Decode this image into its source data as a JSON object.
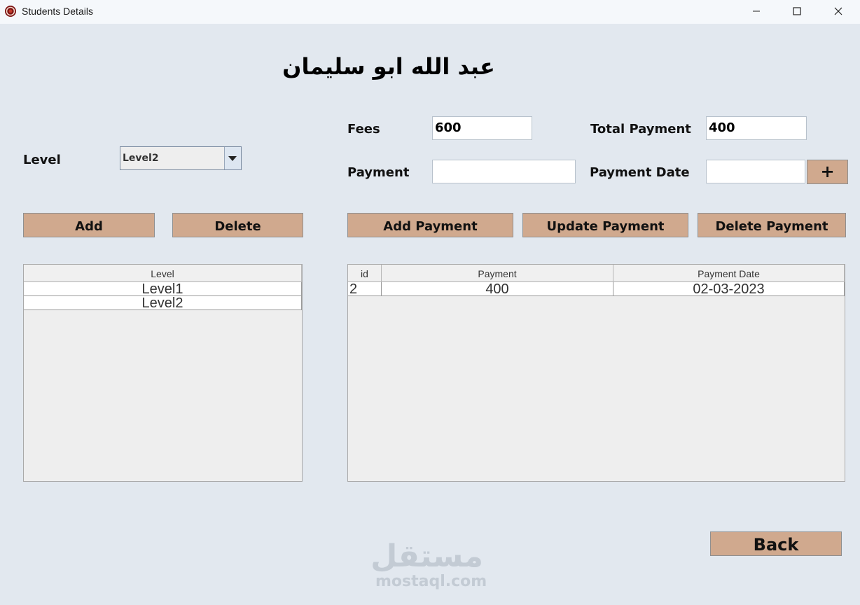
{
  "window": {
    "title": "Students Details"
  },
  "student": {
    "name": "عبد الله ابو سليمان"
  },
  "form": {
    "level_label": "Level",
    "level_selected": "Level2",
    "fees_label": "Fees",
    "fees_value": "600",
    "total_payment_label": "Total Payment",
    "total_payment_value": "400",
    "payment_label": "Payment",
    "payment_value": "",
    "payment_date_label": "Payment Date",
    "payment_date_value": "",
    "date_add_label": "+"
  },
  "buttons": {
    "add": "Add",
    "delete": "Delete",
    "add_payment": "Add Payment",
    "update_payment": "Update Payment",
    "delete_payment": "Delete Payment",
    "back": "Back"
  },
  "levels_table": {
    "columns": [
      "Level"
    ],
    "rows": [
      [
        "Level1"
      ],
      [
        "Level2"
      ]
    ]
  },
  "payments_table": {
    "columns": [
      "id",
      "Payment",
      "Payment Date"
    ],
    "rows": [
      [
        "2",
        "400",
        "02-03-2023"
      ]
    ]
  },
  "watermark": {
    "arabic": "مستقل",
    "latin": "mostaql.com"
  },
  "colors": {
    "window_bg": "#e2e8ef",
    "button_bg": "#d0a98e"
  }
}
